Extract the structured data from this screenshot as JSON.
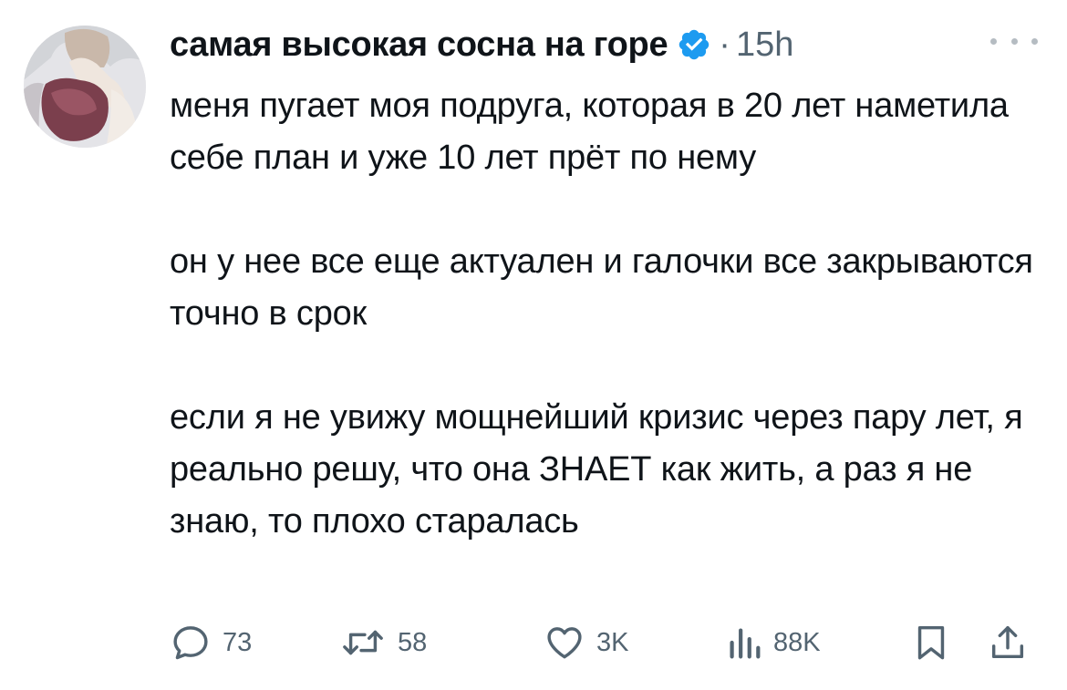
{
  "tweet": {
    "author": "самая высокая сосна на горе",
    "separator": "·",
    "time": "15h",
    "paragraphs": [
      "меня пугает моя подруга, которая в 20 лет наметила себе план и уже 10 лет прёт по нему",
      "он у нее все еще актуален и галочки все закрываются точно в срок",
      "если я не увижу мощнейший кризис через пару лет, я реально решу, что она ЗНАЕТ как жить, а раз я не знаю, то плохо старалась"
    ],
    "metrics": {
      "replies": "73",
      "retweets": "58",
      "likes": "3K",
      "views": "88K"
    }
  },
  "colors": {
    "text": "#0f1419",
    "secondary": "#536471",
    "verified_badge": "#1d9bf0",
    "background": "#ffffff"
  },
  "icons": {
    "verified": "verified-badge-icon",
    "more": "more-icon",
    "reply": "reply-icon",
    "retweet": "retweet-icon",
    "like": "heart-icon",
    "views": "views-chart-icon",
    "bookmark": "bookmark-icon",
    "share": "share-icon"
  }
}
